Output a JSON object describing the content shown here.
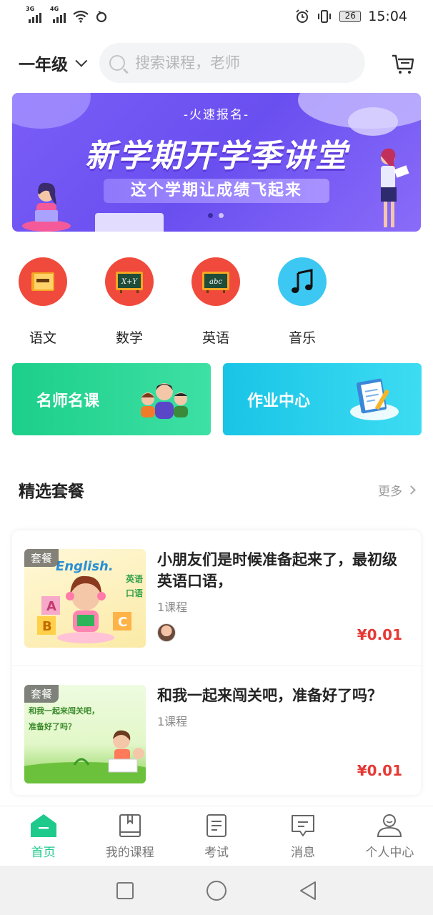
{
  "status_bar": {
    "net1": "3G",
    "net2": "4G",
    "battery": "26",
    "time": "15:04"
  },
  "header": {
    "grade": "一年级",
    "search_placeholder": "搜索课程，老师"
  },
  "banner": {
    "top_text": "-火速报名-",
    "title": "新学期开学季讲堂",
    "subtitle": "这个学期让成绩飞起来"
  },
  "categories": [
    {
      "label": "语文",
      "color": "#f04a3c",
      "icon": "book-icon"
    },
    {
      "label": "数学",
      "color": "#f04a3c",
      "icon": "blackboard-icon",
      "board_text": "X+Y"
    },
    {
      "label": "英语",
      "color": "#f04a3c",
      "icon": "blackboard-icon",
      "board_text": "abc"
    },
    {
      "label": "音乐",
      "color": "#3cc8f2",
      "icon": "music-note-icon"
    }
  ],
  "features": [
    {
      "label": "名师名课"
    },
    {
      "label": "作业中心"
    }
  ],
  "section": {
    "title": "精选套餐",
    "more": "更多"
  },
  "courses": [
    {
      "tag": "套餐",
      "title": "小朋友们是时候准备起来了，最初级英语口语，",
      "count": "1课程",
      "price": "¥0.01",
      "thumb_text": "English.",
      "thumb_side": "英语口语"
    },
    {
      "tag": "套餐",
      "title": "和我一起来闯关吧，准备好了吗？",
      "count": "1课程",
      "price": "¥0.01",
      "thumb_text": "和我一起来闯关吧，准备好了吗？"
    }
  ],
  "tabs": [
    {
      "label": "首页",
      "active": true
    },
    {
      "label": "我的课程"
    },
    {
      "label": "考试"
    },
    {
      "label": "消息"
    },
    {
      "label": "个人中心"
    }
  ],
  "colors": {
    "accent": "#1ec98c",
    "price": "#e53935",
    "banner": "#7b5ef7"
  }
}
